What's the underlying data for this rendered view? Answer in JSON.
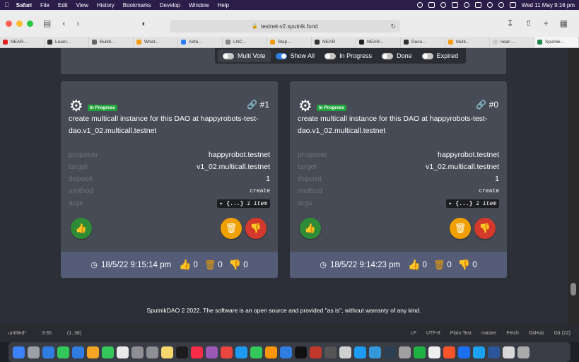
{
  "menubar": {
    "app": "Safari",
    "items": [
      "File",
      "Edit",
      "View",
      "History",
      "Bookmarks",
      "Develop",
      "Window",
      "Help"
    ],
    "datetime": "Wed 11 May  9:16 pm"
  },
  "browser": {
    "url": "testnet-v2.sputnik.fund",
    "tabs": [
      {
        "label": "NEAR...",
        "color": "#e02020"
      },
      {
        "label": "Learn...",
        "color": "#333333"
      },
      {
        "label": "Buildi...",
        "color": "#666666"
      },
      {
        "label": "What...",
        "color": "#f39c12"
      },
      {
        "label": "Airta...",
        "color": "#2d7ff9"
      },
      {
        "label": "LNC...",
        "color": "#888888"
      },
      {
        "label": "Step...",
        "color": "#f39c12"
      },
      {
        "label": "NEAR",
        "color": "#333333"
      },
      {
        "label": "NEAR...",
        "color": "#222222"
      },
      {
        "label": "Dece...",
        "color": "#333333"
      },
      {
        "label": "Multi...",
        "color": "#f39c12"
      },
      {
        "label": "near-...",
        "color": "#cccccc"
      },
      {
        "label": "Sputnik...",
        "color": "#1f8a4c"
      }
    ]
  },
  "filters": [
    {
      "label": "Multi Vote",
      "on": false
    },
    {
      "label": "Show All",
      "on": true
    },
    {
      "label": "In Progress",
      "on": false
    },
    {
      "label": "Done",
      "on": false
    },
    {
      "label": "Expired",
      "on": false
    }
  ],
  "proposals": [
    {
      "status": "In Progress",
      "id": "#1",
      "description": "create multicall instance for this DAO at happyrobots-test-dao.v1_02.multicall.testnet",
      "proposer_label": "proposer",
      "proposer": "happyrobot.testnet",
      "target_label": "target",
      "target": "v1_02.multicall.testnet",
      "deposit_label": "deposit",
      "deposit": "1",
      "method_label": "method",
      "method": "create",
      "args_label": "args",
      "args_brace": "{...}",
      "args_count": "1 item",
      "timestamp": "18/5/22 9:15:14 pm",
      "votes_yes": "0",
      "votes_remove": "0",
      "votes_no": "0"
    },
    {
      "status": "In Progress",
      "id": "#0",
      "description": "create multicall instance for this DAO at happyrobots-test-dao.v1_02.multicall.testnet",
      "proposer_label": "proposer",
      "proposer": "happyrobot.testnet",
      "target_label": "target",
      "target": "v1_02.multicall.testnet",
      "deposit_label": "deposit",
      "deposit": "1",
      "method_label": "method",
      "method": "create",
      "args_label": "args",
      "args_brace": "{...}",
      "args_count": "1 item",
      "timestamp": "18/5/22 9:14:23 pm",
      "votes_yes": "0",
      "votes_remove": "0",
      "votes_no": "0"
    }
  ],
  "footer": "SputnikDAO 2 2022. The software is an open source and provided \"as is\", without warranty of any kind.",
  "editor_status": {
    "file": "untitled*",
    "pos": "3:35",
    "sel": "(1, 38)",
    "lf": "LF",
    "enc": "UTF-8",
    "syntax": "Plain Text",
    "branch": "master",
    "fetch": "Fetch",
    "github": "GitHub",
    "git": "Git (22)"
  },
  "dock_colors": [
    "#3b82f6",
    "#9aa0a6",
    "#2f7de0",
    "#34c759",
    "#2f7de0",
    "#f5a623",
    "#34c759",
    "#e9e9e9",
    "#8e8e93",
    "#8e8e93",
    "#f5d76e",
    "#1c1c1e",
    "#fa2d48",
    "#9b59b6",
    "#e9463f",
    "#1d9bf0",
    "#34c759",
    "#ff9500",
    "#2f7de0",
    "#111111",
    "#c0392b",
    "#555555",
    "#d0d0d0",
    "#1d9bf0",
    "#3498db",
    "#2c3e50",
    "#a0a0a0",
    "#1fb141",
    "#eeeeee",
    "#fb542b",
    "#1d6ff2",
    "#1da1f2",
    "#2b579a",
    "#d8d8d8",
    "#aaaaaa"
  ]
}
